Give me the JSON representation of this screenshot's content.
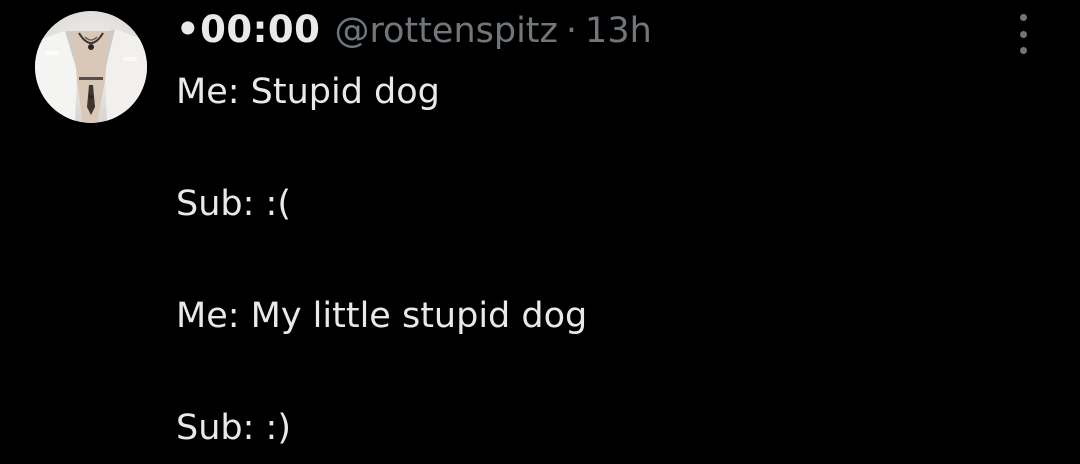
{
  "tweet": {
    "display_name": "•00:00",
    "handle": "@rottenspitz",
    "separator": "·",
    "time": "13h",
    "lines": [
      "Me: Stupid dog",
      "",
      "Sub: :(",
      "",
      "Me: My little stupid dog",
      "",
      "Sub: :)"
    ]
  },
  "icons": {
    "more": "more-vertical-icon",
    "avatar": "profile-avatar"
  },
  "colors": {
    "background": "#000000",
    "primary_text": "#e7e9ea",
    "secondary_text": "#71767b"
  }
}
